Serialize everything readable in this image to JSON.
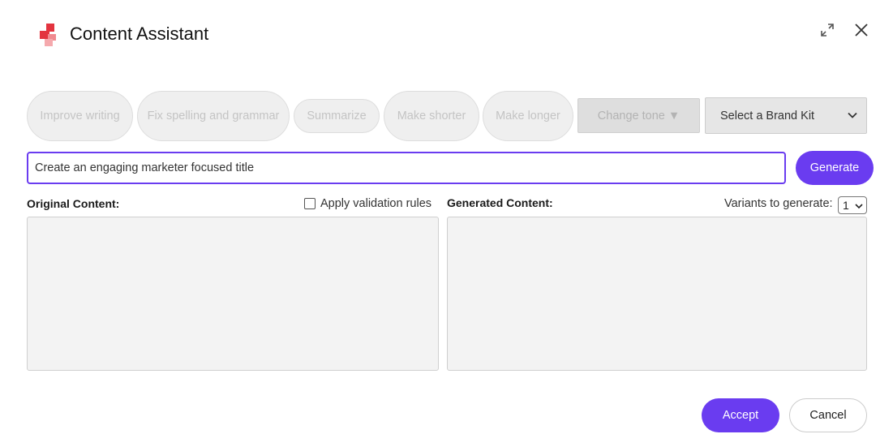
{
  "header": {
    "title": "Content Assistant",
    "logo_icon": "brand-logo-icon",
    "expand_icon": "expand-icon",
    "close_icon": "close-icon"
  },
  "actions": {
    "improve_writing": "Improve writing",
    "fix_spelling": "Fix spelling and grammar",
    "summarize": "Summarize",
    "make_shorter": "Make shorter",
    "make_longer": "Make longer",
    "change_tone": "Change tone",
    "change_tone_caret": "▼",
    "brand_kit": "Select a Brand Kit"
  },
  "prompt": {
    "value": "Create an engaging marketer focused title",
    "generate_label": "Generate"
  },
  "original": {
    "label": "Original Content:",
    "validation_label": "Apply validation rules",
    "validation_checked": false
  },
  "generated": {
    "label": "Generated Content:",
    "variants_label": "Variants to generate:",
    "variants_value": "1"
  },
  "footer": {
    "accept_label": "Accept",
    "cancel_label": "Cancel"
  },
  "colors": {
    "accent": "#6a3cf0",
    "brand_red": "#e3343f",
    "disabled_bg": "#efefef",
    "disabled_text": "#c4c4c4"
  }
}
